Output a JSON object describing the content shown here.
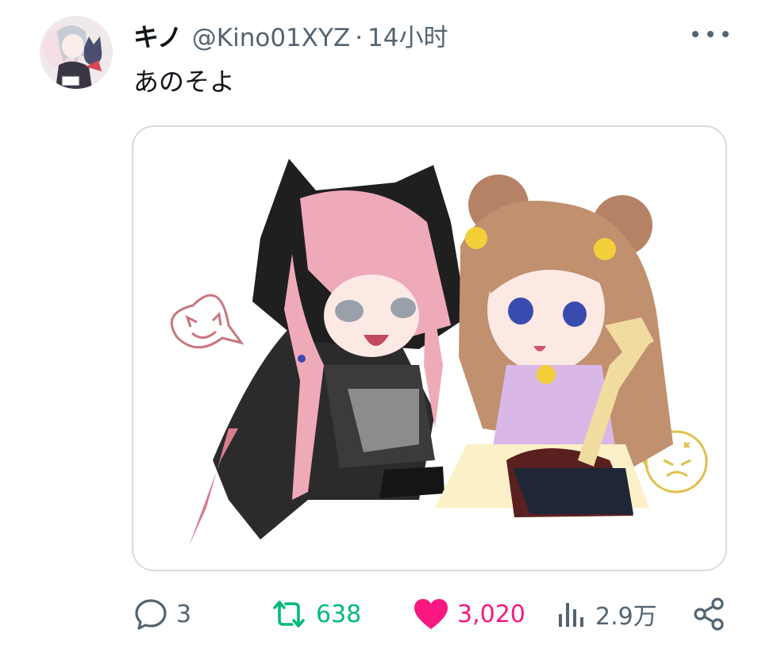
{
  "tweet": {
    "display_name": "キノ",
    "handle": "@Kino01XYZ",
    "separator": "·",
    "time": "14小时",
    "text": "あのそよ"
  },
  "actions": {
    "reply_count": "3",
    "retweet_count": "638",
    "like_count": "3,020",
    "views_count": "2.9万"
  },
  "icons": {
    "more": "more-horizontal-icon",
    "reply": "speech-bubble-icon",
    "retweet": "retweet-icon",
    "like": "heart-icon",
    "views": "bar-chart-icon",
    "share": "share-icon"
  },
  "colors": {
    "retweet": "#00ba7c",
    "like": "#f91880",
    "muted": "#536471"
  }
}
